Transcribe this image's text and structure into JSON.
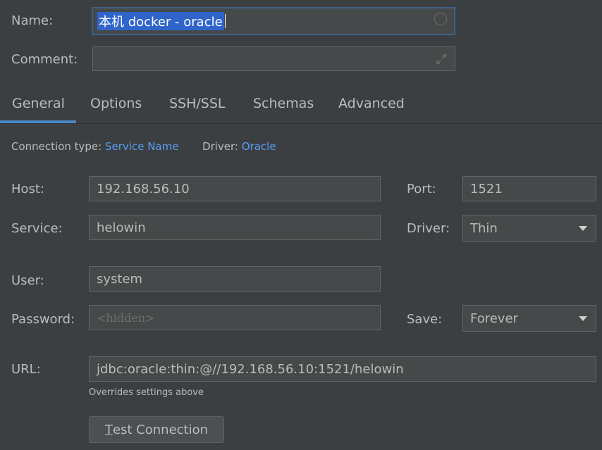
{
  "form": {
    "name_label": "Name:",
    "name_value": "本机 docker - oracle",
    "comment_label": "Comment:",
    "comment_value": ""
  },
  "tabs": [
    {
      "label": "General",
      "active": true
    },
    {
      "label": "Options",
      "active": false
    },
    {
      "label": "SSH/SSL",
      "active": false
    },
    {
      "label": "Schemas",
      "active": false
    },
    {
      "label": "Advanced",
      "active": false
    }
  ],
  "connection": {
    "type_label": "Connection type:",
    "type_value": "Service Name",
    "driver_label": "Driver:",
    "driver_value": "Oracle"
  },
  "fields": {
    "host_label": "Host:",
    "host_value": "192.168.56.10",
    "port_label": "Port:",
    "port_value": "1521",
    "service_label": "Service:",
    "service_value": "helowin",
    "driver_label": "Driver:",
    "driver_selected": "Thin",
    "user_label": "User:",
    "user_value": "system",
    "password_label": "Password:",
    "password_placeholder": "<hidden>",
    "save_label": "Save:",
    "save_selected": "Forever",
    "url_label": "URL:",
    "url_value": "jdbc:oracle:thin:@//192.168.56.10:1521/helowin",
    "url_note": "Overrides settings above"
  },
  "test_button": {
    "mnemonic": "T",
    "rest": "est Connection"
  },
  "colors": {
    "background": "#3c3f41",
    "field_bg": "#45494a",
    "accent": "#4a88c7",
    "link": "#589df6",
    "selection": "#2f65ca"
  },
  "icons": {
    "name_field": "circle-icon",
    "comment_field": "expand-icon",
    "combo": "chevron-down-icon"
  }
}
